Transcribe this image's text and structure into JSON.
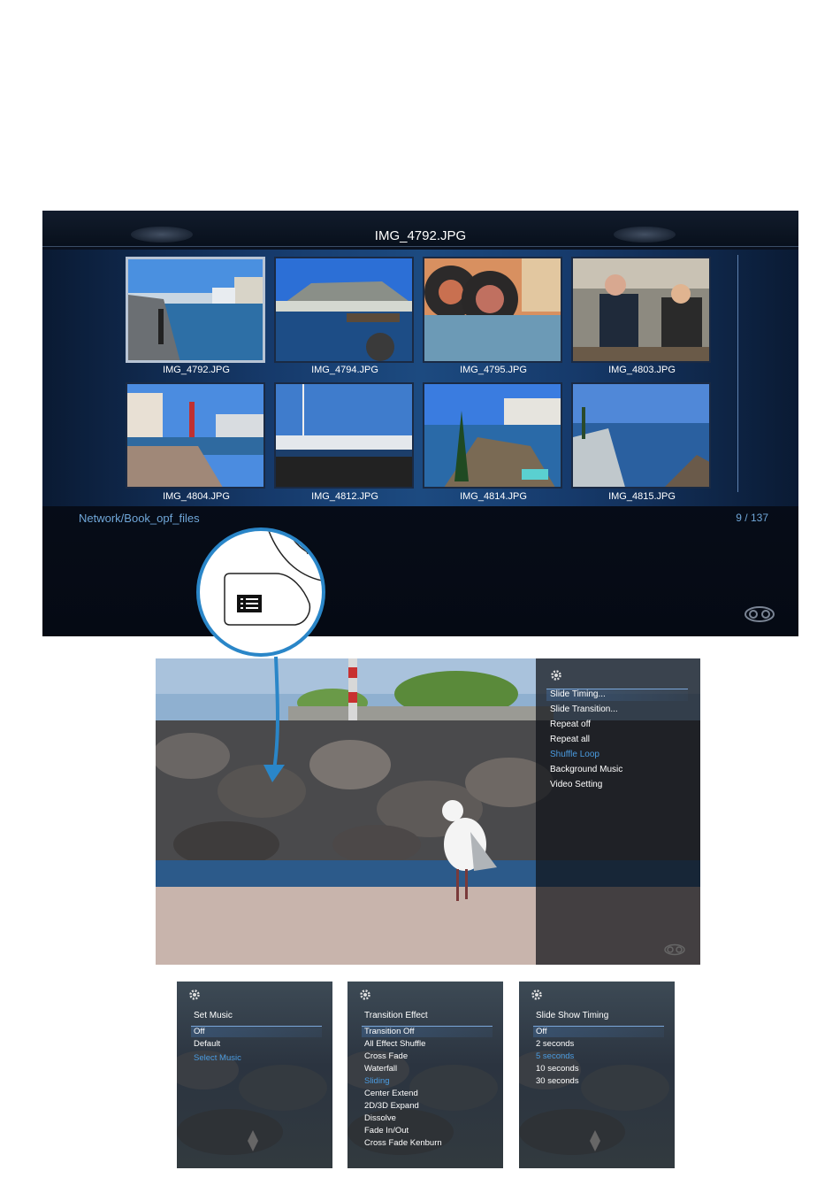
{
  "browser": {
    "title": "IMG_4792.JPG",
    "path": "Network/Book_opf_files",
    "counter": "9 / 137",
    "thumbnails": [
      {
        "label": "IMG_4792.JPG",
        "selected": true
      },
      {
        "label": "IMG_4794.JPG",
        "selected": false
      },
      {
        "label": "IMG_4795.JPG",
        "selected": false
      },
      {
        "label": "IMG_4803.JPG",
        "selected": false
      },
      {
        "label": "IMG_4804.JPG",
        "selected": false
      },
      {
        "label": "IMG_4812.JPG",
        "selected": false
      },
      {
        "label": "IMG_4814.JPG",
        "selected": false
      },
      {
        "label": "IMG_4815.JPG",
        "selected": false
      }
    ]
  },
  "callout": {
    "icon": "menu-list-icon",
    "accent": "#2a86c8"
  },
  "slideshow_menu": {
    "icon": "gear-icon",
    "items": [
      {
        "label": "Slide Timing...",
        "highlight": false
      },
      {
        "label": "Slide Transition...",
        "highlight": false
      },
      {
        "label": "Repeat off",
        "highlight": false
      },
      {
        "label": "Repeat all",
        "highlight": false
      },
      {
        "label": "Shuffle Loop",
        "highlight": true
      },
      {
        "label": "Background Music",
        "highlight": false
      },
      {
        "label": "Video Setting",
        "highlight": false
      }
    ]
  },
  "set_music": {
    "title": "Set Music",
    "items": [
      {
        "label": "Off",
        "highlight": false
      },
      {
        "label": "Default",
        "highlight": false
      },
      {
        "label": "Select Music",
        "highlight": true
      }
    ]
  },
  "transition_effect": {
    "title": "Transition Effect",
    "items": [
      {
        "label": "Transition Off",
        "highlight": false
      },
      {
        "label": "All Effect Shuffle",
        "highlight": false
      },
      {
        "label": "Cross Fade",
        "highlight": false
      },
      {
        "label": "Waterfall",
        "highlight": false
      },
      {
        "label": "Sliding",
        "highlight": true
      },
      {
        "label": "Center Extend",
        "highlight": false
      },
      {
        "label": "2D/3D Expand",
        "highlight": false
      },
      {
        "label": "Dissolve",
        "highlight": false
      },
      {
        "label": "Fade In/Out",
        "highlight": false
      },
      {
        "label": "Cross Fade Kenburn",
        "highlight": false
      }
    ]
  },
  "slide_show_timing": {
    "title": "Slide Show Timing",
    "items": [
      {
        "label": "Off",
        "highlight": false
      },
      {
        "label": "2 seconds",
        "highlight": false
      },
      {
        "label": "5 seconds",
        "highlight": true
      },
      {
        "label": "10 seconds",
        "highlight": false
      },
      {
        "label": "30 seconds",
        "highlight": false
      }
    ]
  },
  "colors": {
    "highlight": "#4a9be0",
    "path_text": "#6fa6d8"
  }
}
